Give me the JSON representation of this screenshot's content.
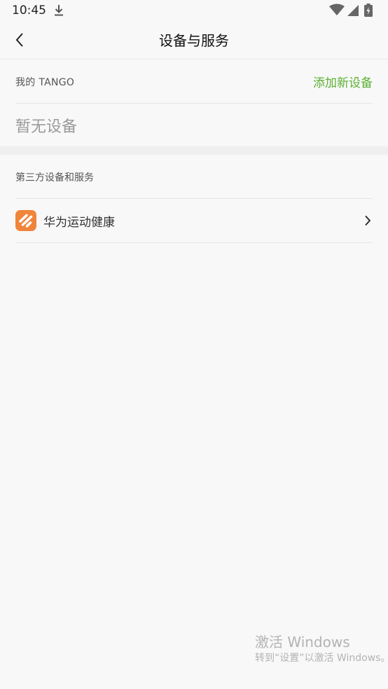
{
  "status_bar": {
    "time": "10:45",
    "icons": [
      "download-icon",
      "wifi-icon",
      "signal-icon",
      "battery-icon"
    ]
  },
  "header": {
    "title": "设备与服务",
    "back_icon": "chevron-left-icon"
  },
  "my_devices": {
    "label": "我的 TANGO",
    "add_label": "添加新设备",
    "empty_text": "暂无设备"
  },
  "third_party": {
    "label": "第三方设备和服务",
    "items": [
      {
        "label": "华为运动健康",
        "icon": "huawei-health-icon"
      }
    ]
  },
  "watermark": {
    "title": "激活 Windows",
    "subtitle": "转到“设置”以激活 Windows。"
  },
  "colors": {
    "accent_green": "#5bb033",
    "background": "#f8f8f8",
    "huawei_health_orange": "#f0843a"
  }
}
